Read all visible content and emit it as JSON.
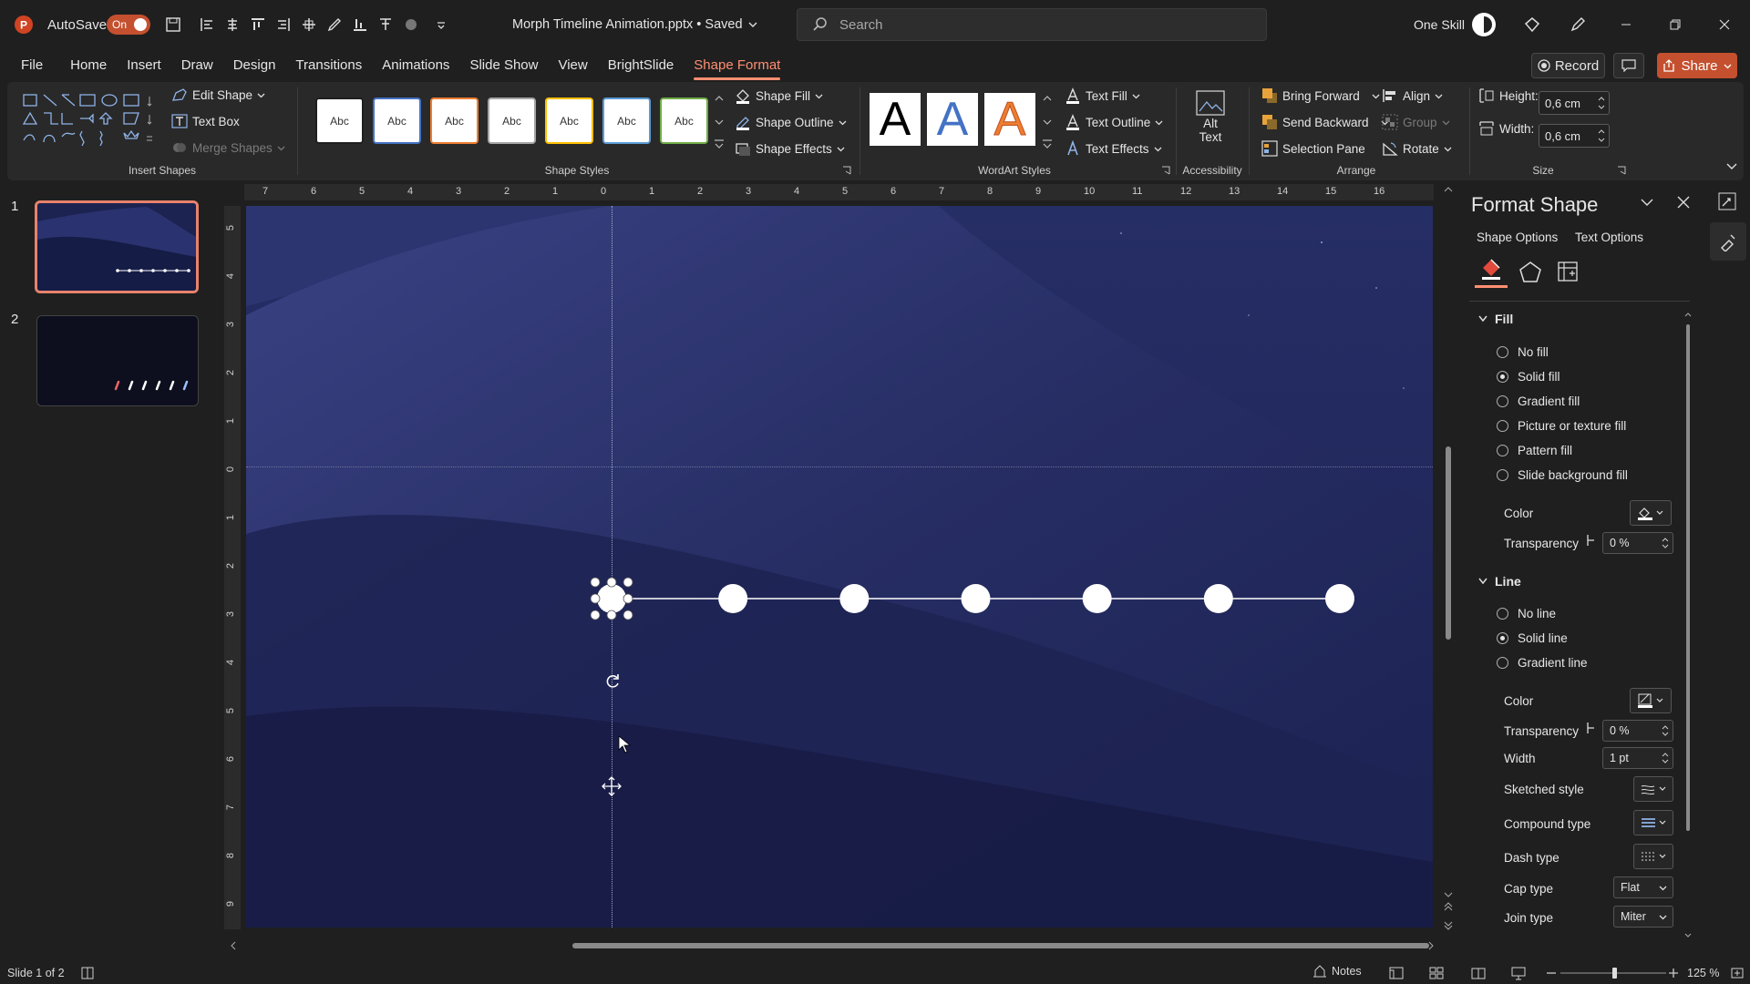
{
  "titlebar": {
    "autosave_label": "AutoSave",
    "autosave_state": "On",
    "file_title": "Morph Timeline Animation.pptx • Saved",
    "search_placeholder": "Search",
    "user_name": "One Skill"
  },
  "tabs": [
    "File",
    "Home",
    "Insert",
    "Draw",
    "Design",
    "Transitions",
    "Animations",
    "Slide Show",
    "View",
    "BrightSlide",
    "Shape Format"
  ],
  "active_tab": "Shape Format",
  "top_right": {
    "record_label": "Record",
    "share_label": "Share"
  },
  "ribbon": {
    "insert_shapes": {
      "label": "Insert Shapes",
      "edit_shape": "Edit Shape",
      "text_box": "Text Box",
      "merge_shapes": "Merge Shapes"
    },
    "shape_styles": {
      "label": "Shape Styles",
      "preview_text": "Abc",
      "fill": "Shape Fill",
      "outline": "Shape Outline",
      "effects": "Shape Effects",
      "swatch_colors": [
        "#1f1f1f",
        "#4472c4",
        "#ed7d31",
        "#a5a5a5",
        "#ffc000",
        "#5b9bd5",
        "#70ad47"
      ]
    },
    "wordart": {
      "label": "WordArt Styles",
      "letter": "A",
      "text_fill": "Text Fill",
      "text_outline": "Text Outline",
      "text_effects": "Text Effects"
    },
    "accessibility": {
      "label": "Accessibility",
      "alt_text_1": "Alt",
      "alt_text_2": "Text"
    },
    "arrange": {
      "label": "Arrange",
      "bring_forward": "Bring Forward",
      "send_backward": "Send Backward",
      "selection_pane": "Selection Pane",
      "align": "Align",
      "group": "Group",
      "rotate": "Rotate"
    },
    "size": {
      "label": "Size",
      "height_label": "Height:",
      "height_value": "0,6 cm",
      "width_label": "Width:",
      "width_value": "0,6 cm"
    }
  },
  "thumbnails": [
    {
      "number": "1",
      "selected": true
    },
    {
      "number": "2",
      "selected": false
    }
  ],
  "rulers": {
    "horizontal": [
      "7",
      "6",
      "5",
      "4",
      "3",
      "2",
      "1",
      "0",
      "1",
      "2",
      "3",
      "4",
      "5",
      "6",
      "7",
      "8",
      "9",
      "10",
      "11",
      "12",
      "13",
      "14",
      "15",
      "16"
    ],
    "vertical": [
      "5",
      "4",
      "3",
      "2",
      "1",
      "0",
      "1",
      "2",
      "3",
      "4",
      "5",
      "6",
      "7",
      "8",
      "9"
    ]
  },
  "timeline": {
    "dot_count": 7,
    "color": "#ffffff"
  },
  "format_pane": {
    "title": "Format Shape",
    "tab_shape_options": "Shape Options",
    "tab_text_options": "Text Options",
    "fill_section": "Fill",
    "fill_options": [
      {
        "label": "No fill",
        "selected": false
      },
      {
        "label": "Solid fill",
        "selected": true
      },
      {
        "label": "Gradient fill",
        "selected": false
      },
      {
        "label": "Picture or texture fill",
        "selected": false
      },
      {
        "label": "Pattern fill",
        "selected": false
      },
      {
        "label": "Slide background fill",
        "selected": false
      }
    ],
    "fill_color_label": "Color",
    "fill_transparency_label": "Transparency",
    "fill_transparency_value": "0 %",
    "line_section": "Line",
    "line_options": [
      {
        "label": "No line",
        "selected": false
      },
      {
        "label": "Solid line",
        "selected": true
      },
      {
        "label": "Gradient line",
        "selected": false
      }
    ],
    "line_color_label": "Color",
    "line_transparency_label": "Transparency",
    "line_transparency_value": "0 %",
    "width_label": "Width",
    "width_value": "1 pt",
    "sketched_label": "Sketched style",
    "compound_label": "Compound type",
    "dash_label": "Dash type",
    "cap_label": "Cap type",
    "cap_value": "Flat",
    "join_label": "Join type",
    "join_value": "Miter"
  },
  "statusbar": {
    "slide_info": "Slide 1 of 2",
    "notes_label": "Notes",
    "zoom": "125 %"
  },
  "colors": {
    "accent": "#ff8f72",
    "share_button": "#c4502f",
    "slide_bg": "#1a2146"
  }
}
